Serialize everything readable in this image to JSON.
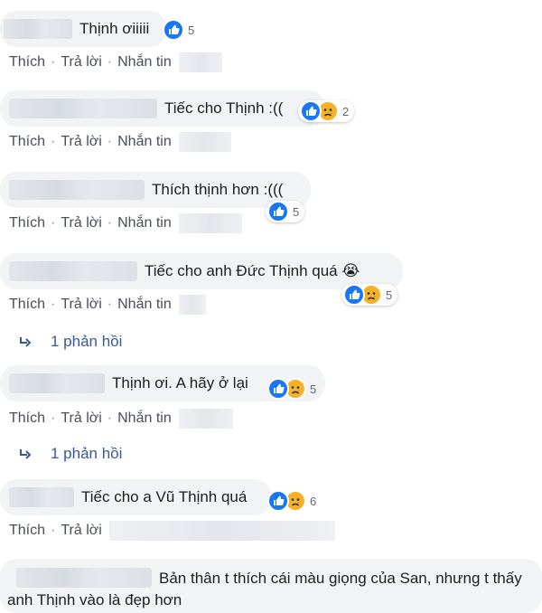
{
  "comments": [
    {
      "text": "Thịnh ơiiiii",
      "count": "5",
      "reactions": [
        "like-icon"
      ]
    },
    {
      "text": "Tiếc cho Thịnh :((",
      "count": "2",
      "reactions": [
        "like-icon",
        "sad-icon"
      ]
    },
    {
      "text": "Thích thịnh hơn :(((",
      "count": "5",
      "reactions": [
        "like-icon"
      ]
    },
    {
      "text": "Tiếc cho anh Đức Thịnh quá 😭",
      "count": "5",
      "reactions": [
        "like-icon",
        "sad-icon"
      ],
      "replies": "1 phản hồi"
    },
    {
      "text": "Thịnh ơi. A hãy ở lại",
      "count": "5",
      "reactions": [
        "like-icon",
        "sad-icon"
      ],
      "replies": "1 phản hồi"
    },
    {
      "text": "Tiếc cho a Vũ Thịnh quá",
      "count": "6",
      "reactions": [
        "like-icon",
        "sad-icon"
      ]
    },
    {
      "text": "Bản thân t thích cái màu giọng của San, nhưng t thấy anh Thịnh vào là đẹp hơn"
    }
  ],
  "actions": {
    "like": "Thích",
    "reply": "Trả lời",
    "message": "Nhắn tin"
  },
  "colors": {
    "bubble": "#f2f3f5",
    "like_blue": "#1877f2",
    "sad_yellow": "#f7b125",
    "link": "#385898"
  }
}
